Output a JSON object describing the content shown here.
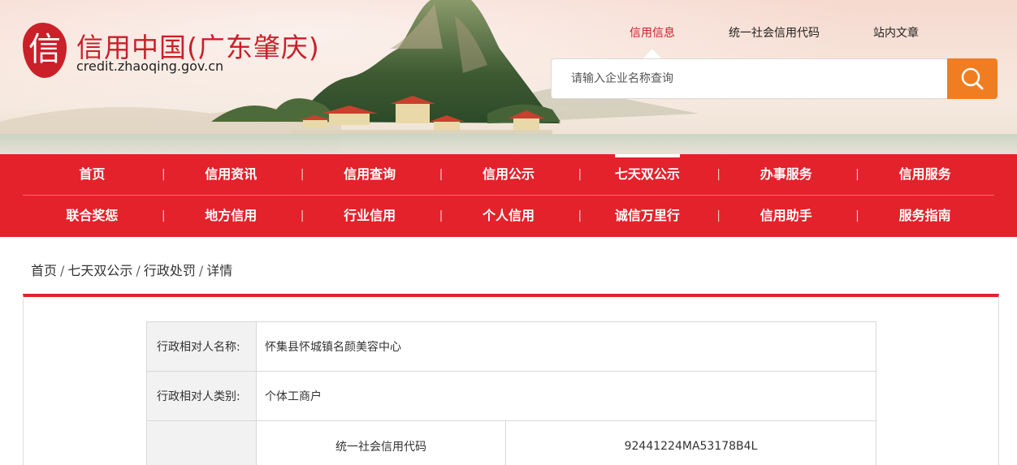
{
  "header": {
    "logo_char": "信",
    "site_title": "信用中国(广东肇庆)",
    "site_url": "credit.zhaoqing.gov.cn",
    "top_nav": [
      {
        "label": "信用信息",
        "active": true
      },
      {
        "label": "统一社会信用代码",
        "active": false
      },
      {
        "label": "站内文章",
        "active": false
      }
    ],
    "search": {
      "placeholder": "请输入企业名称查询",
      "button_icon": "search-icon"
    }
  },
  "main_nav": {
    "row1": [
      "首页",
      "信用资讯",
      "信用查询",
      "信用公示",
      "七天双公示",
      "办事服务",
      "信用服务"
    ],
    "row2": [
      "联合奖惩",
      "地方信用",
      "行业信用",
      "个人信用",
      "诚信万里行",
      "信用助手",
      "服务指南"
    ],
    "active": "七天双公示"
  },
  "breadcrumb": {
    "items": [
      "首页",
      "七天双公示",
      "行政处罚",
      "详情"
    ],
    "separator": "/"
  },
  "detail": {
    "rows": [
      {
        "label": "行政相对人名称:",
        "value": "怀集县怀城镇名颜美容中心"
      },
      {
        "label": "行政相对人类别:",
        "value": "个体工商户"
      }
    ],
    "code_row": {
      "sub_label": "统一社会信用代码",
      "sub_value": "92441224MA53178B4L"
    }
  },
  "colors": {
    "brand_red": "#e3222b",
    "search_orange": "#f07d22",
    "logo_red": "#c9202a"
  }
}
